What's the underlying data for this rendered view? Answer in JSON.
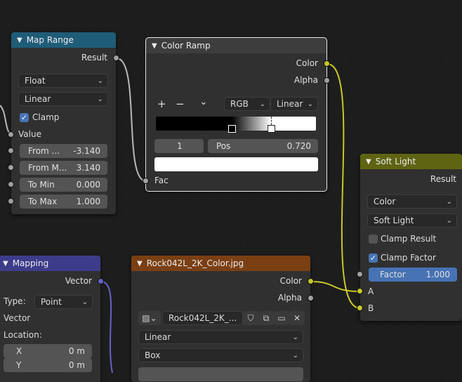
{
  "map_range": {
    "title": "Map Range",
    "result": "Result",
    "data_type": "Float",
    "interpolation": "Linear",
    "clamp_label": "Clamp",
    "clamp_checked": true,
    "value_label": "Value",
    "from_min_label": "From ...",
    "from_min_value": "-3.140",
    "from_max_label": "From M...",
    "from_max_value": "3.140",
    "to_min_label": "To Min",
    "to_min_value": "0.000",
    "to_max_label": "To Max",
    "to_max_value": "1.000"
  },
  "color_ramp": {
    "title": "Color Ramp",
    "color_out": "Color",
    "alpha_out": "Alpha",
    "add_glyph": "+",
    "remove_glyph": "−",
    "menu_glyph": "⌄",
    "color_mode": "RGB",
    "interpolation": "Linear",
    "active_index": "1",
    "pos_label": "Pos",
    "pos_value": "0.720",
    "fac_label": "Fac"
  },
  "soft_light": {
    "title": "Soft Light",
    "result": "Result",
    "data_type": "Color",
    "blend_mode": "Soft Light",
    "clamp_result_label": "Clamp Result",
    "clamp_result_checked": false,
    "clamp_factor_label": "Clamp Factor",
    "clamp_factor_checked": true,
    "factor_label": "Factor",
    "factor_value": "1.000",
    "a_label": "A",
    "b_label": "B"
  },
  "mapping": {
    "title": "Mapping",
    "vector_out": "Vector",
    "type_label": "Type:",
    "type_value": "Point",
    "vector_label": "Vector",
    "location_label": "Location:",
    "x_label": "X",
    "x_value": "0 m",
    "y_label": "Y",
    "y_value": "0 m"
  },
  "image_texture": {
    "title": "Rock042L_2K_Color.jpg",
    "color_out": "Color",
    "alpha_out": "Alpha",
    "image_name": "Rock042L_2K_...",
    "interpolation": "Linear",
    "projection": "Box"
  },
  "colors": {
    "map_range_header": "#1f5c78",
    "soft_light_header": "#5f6412",
    "mapping_header": "#3c3c8b",
    "image_header": "#7a3f13",
    "color_socket": "#c7c729",
    "float_socket": "#a1a1a1",
    "vector_socket": "#6363c7",
    "accent": "#4772b3"
  }
}
